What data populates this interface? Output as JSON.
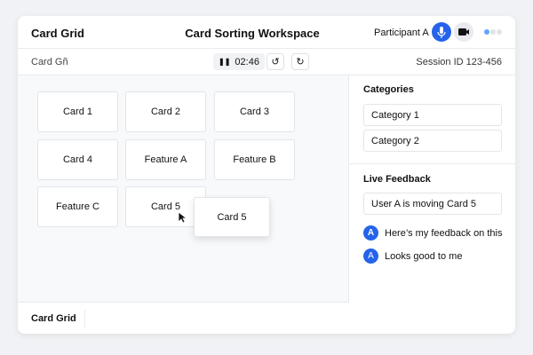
{
  "header": {
    "app_name": "Card Grid",
    "title": "Card Sorting Workspace",
    "participant": "Participant A"
  },
  "toolbar": {
    "breadcrumb": "Card Gñ",
    "timer": "02:46",
    "session": "Session ID 123-456"
  },
  "cards": [
    "Card 1",
    "Card 2",
    "Card 3",
    "Card 4",
    "Feature A",
    "Feature B",
    "Feature C",
    "Card 5"
  ],
  "dragged_card": "Card 5",
  "footer": {
    "label": "Card Grid"
  },
  "categories": {
    "title": "Categories",
    "items": [
      "Category 1",
      "Category 2"
    ]
  },
  "feedback": {
    "title": "Live Feedback",
    "status": "User A is moving Card 5",
    "items": [
      {
        "avatar": "A",
        "text": "Here’s my feedback on this"
      },
      {
        "avatar": "A",
        "text": "Looks good to me"
      }
    ]
  },
  "colors": {
    "accent": "#2563eb"
  }
}
